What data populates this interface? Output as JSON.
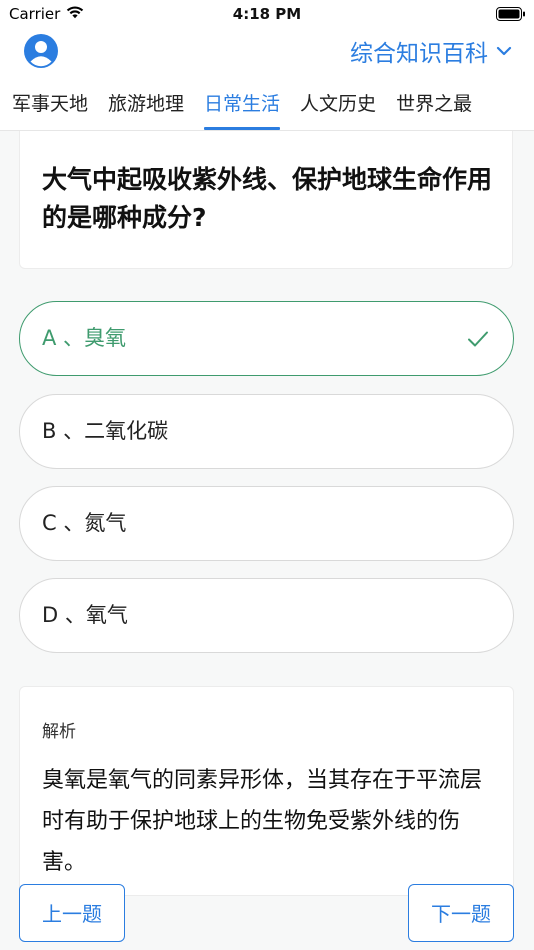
{
  "status_bar": {
    "carrier": "Carrier",
    "time": "4:18 PM"
  },
  "header": {
    "category": "综合知识百科",
    "avatar_icon": "user-avatar-icon",
    "dropdown_icon": "chevron-down-icon",
    "accent_color": "#2b7de0"
  },
  "tabs": [
    {
      "label": "军事天地",
      "active": false
    },
    {
      "label": "旅游地理",
      "active": false
    },
    {
      "label": "日常生活",
      "active": true
    },
    {
      "label": "人文历史",
      "active": false
    },
    {
      "label": "世界之最",
      "active": false
    }
  ],
  "question": {
    "text": "大气中起吸收紫外线、保护地球生命作用的是哪种成分?"
  },
  "options": [
    {
      "label": "A 、臭氧",
      "correct": true
    },
    {
      "label": "B 、二氧化碳",
      "correct": false
    },
    {
      "label": "C 、氮气",
      "correct": false
    },
    {
      "label": "D 、氧气",
      "correct": false
    }
  ],
  "correct_color": "#3f9b6e",
  "explanation": {
    "title": "解析",
    "text": "臭氧是氧气的同素异形体，当其存在于平流层时有助于保护地球上的生物免受紫外线的伤害。"
  },
  "nav": {
    "prev_label": "上一题",
    "next_label": "下一题"
  }
}
